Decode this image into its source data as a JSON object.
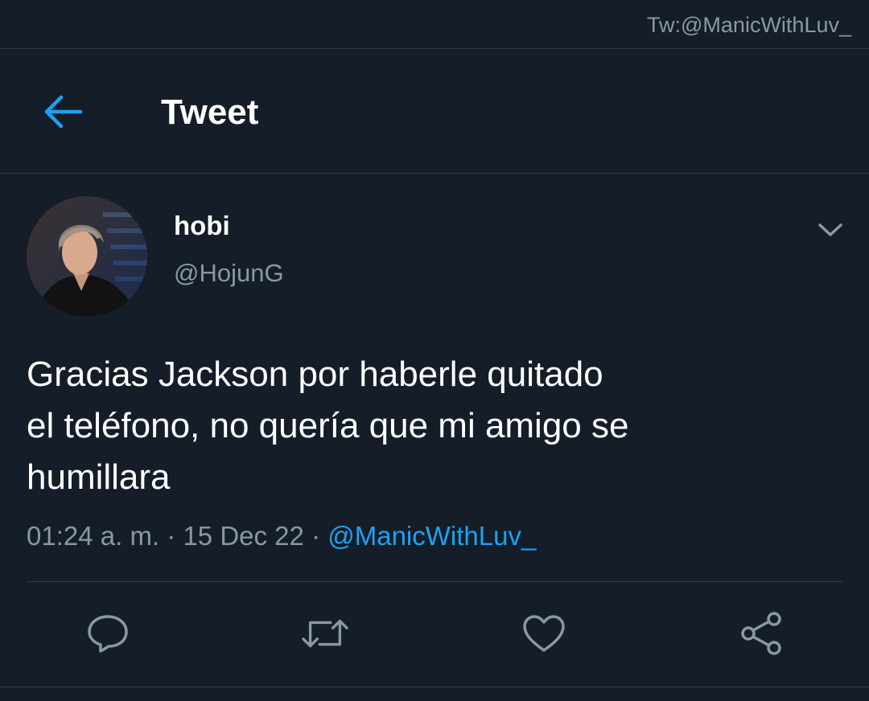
{
  "watermark": "Tw:@ManicWithLuv_",
  "header": {
    "title": "Tweet",
    "back_icon": "arrow-left-icon"
  },
  "tweet": {
    "author": {
      "display_name": "hobi",
      "handle": "@HojunG"
    },
    "text_lines": [
      "Gracias Jackson por haberle quitado",
      "el teléfono, no quería que mi amigo se",
      "humillara"
    ],
    "time": "01:24 a. m.",
    "separator": "·",
    "date": "15 Dec 22",
    "via": "@ManicWithLuv_"
  },
  "actions": [
    {
      "icon": "reply-icon"
    },
    {
      "icon": "retweet-icon"
    },
    {
      "icon": "like-icon"
    },
    {
      "icon": "share-icon"
    }
  ],
  "colors": {
    "background": "#151d28",
    "accent": "#1da1f2",
    "secondary_text": "#8899a6",
    "divider": "#2f3a46"
  }
}
